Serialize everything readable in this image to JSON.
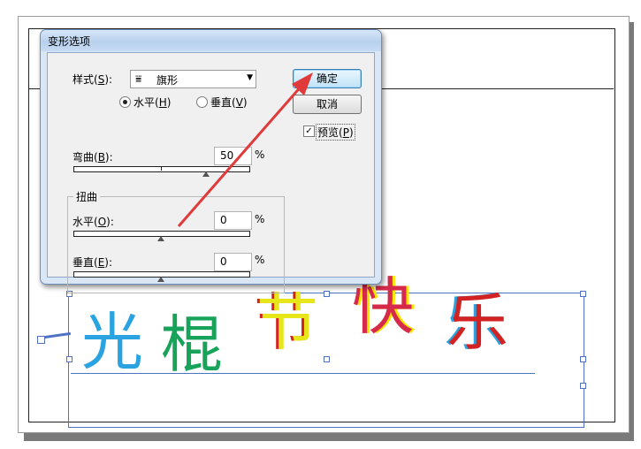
{
  "dialog": {
    "title": "变形选项",
    "style_label": "样式(",
    "style_key": "S",
    "style_label_end": "):",
    "style_value": "旗形",
    "style_icon": "flag-warp-icon",
    "orientation": {
      "horizontal": {
        "text": "水平(",
        "key": "H",
        "end": ")",
        "selected": true
      },
      "vertical": {
        "text": "垂直(",
        "key": "V",
        "end": ")",
        "selected": false
      }
    },
    "bend": {
      "label": "弯曲(",
      "key": "B",
      "end": "):",
      "value": "50",
      "unit": "%",
      "level_pct": 50
    },
    "distortion": {
      "group_title": "扭曲",
      "horizontal": {
        "label": "水平(",
        "key": "O",
        "end": "):",
        "value": "0",
        "unit": "%",
        "level_pct": 0
      },
      "vertical": {
        "label": "垂直(",
        "key": "E",
        "end": "):",
        "value": "0",
        "unit": "%",
        "level_pct": 0
      }
    },
    "buttons": {
      "ok": "确定",
      "cancel": "取消"
    },
    "preview": {
      "text": "预览(",
      "key": "P",
      "end": ")",
      "checked": true
    }
  },
  "artwork": {
    "chars": [
      "光",
      "棍",
      "节",
      "快",
      "乐"
    ]
  },
  "annotation": {
    "arrow_color": "#e03a3a",
    "description": "arrow-pointing-to-ok-button"
  }
}
